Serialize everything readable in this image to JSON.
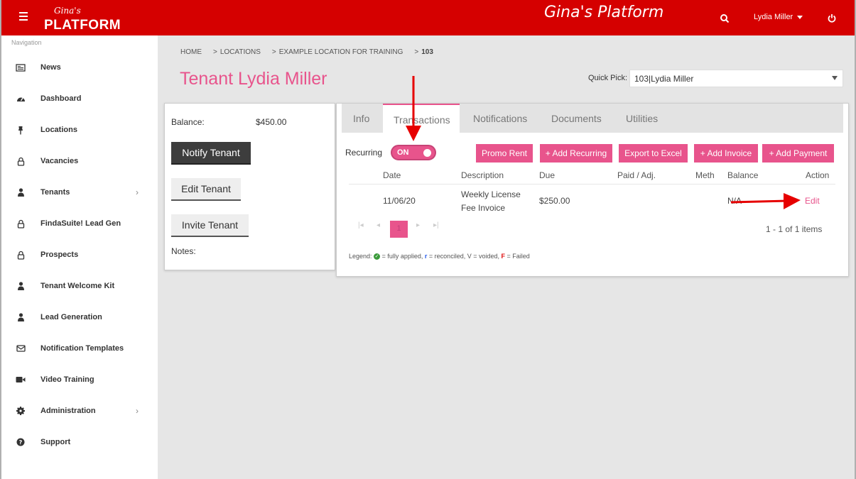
{
  "header": {
    "logo_script": "Gina's",
    "logo_word": "PLATFORM",
    "brand_title": "Gina's Platform",
    "user_name": "Lydia Miller",
    "accent_color": "#d50000"
  },
  "sidebar": {
    "heading": "Navigation",
    "items": [
      {
        "label": "News",
        "icon": "newspaper-icon"
      },
      {
        "label": "Dashboard",
        "icon": "dashboard-icon"
      },
      {
        "label": "Locations",
        "icon": "pin-icon"
      },
      {
        "label": "Vacancies",
        "icon": "lock-icon"
      },
      {
        "label": "Tenants",
        "icon": "user-icon"
      },
      {
        "label": "FindaSuite! Lead Gen",
        "icon": "lock-icon"
      },
      {
        "label": "Prospects",
        "icon": "lock-icon"
      },
      {
        "label": "Tenant Welcome Kit",
        "icon": "user-icon"
      },
      {
        "label": "Lead Generation",
        "icon": "user-icon"
      },
      {
        "label": "Notification Templates",
        "icon": "envelope-icon"
      },
      {
        "label": "Video Training",
        "icon": "video-icon"
      },
      {
        "label": "Administration",
        "icon": "gear-icon"
      },
      {
        "label": "Support",
        "icon": "question-icon"
      }
    ]
  },
  "breadcrumb": {
    "home": "HOME",
    "locations": "LOCATIONS",
    "location": "EXAMPLE LOCATION FOR TRAINING",
    "unit": "103",
    "sep": ">"
  },
  "page": {
    "title": "Tenant Lydia Miller",
    "quick_pick_label": "Quick Pick:",
    "quick_pick_value": "103|Lydia Miller"
  },
  "left_card": {
    "balance_label": "Balance:",
    "balance_value": "$450.00",
    "notify_label": "Notify Tenant",
    "edit_label": "Edit Tenant",
    "invite_label": "Invite Tenant",
    "notes_label": "Notes:"
  },
  "tabs": [
    "Info",
    "Transactions",
    "Notifications",
    "Documents",
    "Utilities"
  ],
  "transactions": {
    "recurring_label": "Recurring",
    "toggle_text": "ON",
    "buttons": {
      "promo": "Promo Rent",
      "add_recurring": "+ Add Recurring",
      "export": "Export to Excel",
      "add_invoice": "+ Add Invoice",
      "add_payment": "+ Add Payment"
    },
    "columns": [
      "Date",
      "Description",
      "Due",
      "Paid / Adj.",
      "Meth",
      "Balance",
      "Action"
    ],
    "rows": [
      {
        "date": "11/06/20",
        "desc_line1": "Weekly License",
        "desc_line2": "Fee Invoice",
        "due": "$250.00",
        "paid": "",
        "meth": "",
        "balance": "N/A",
        "action": "Edit"
      }
    ],
    "pager": {
      "first": "|◂",
      "prev": "◂",
      "current": "1",
      "next": "▸",
      "last": "▸|",
      "info": "1 - 1 of 1 items"
    },
    "legend": {
      "prefix": "Legend:",
      "check": "✓",
      "applied": "= fully applied,",
      "r": "r",
      "reconciled": "= reconciled, V = voided,",
      "f": "F",
      "failed": "= Failed"
    }
  },
  "colors": {
    "pink": "#e8548c",
    "annotation_red": "#e60000"
  }
}
